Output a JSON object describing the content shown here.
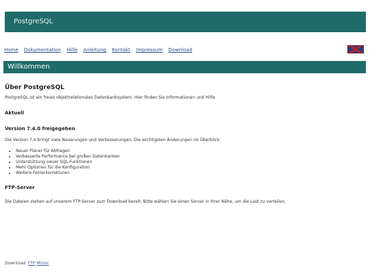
{
  "brand": "PostgreSQL",
  "nav_items": [
    "Home",
    "Dokumentation",
    "Hilfe",
    "Anleitung",
    "Kontakt",
    "Impressum",
    "Download"
  ],
  "section_title": "Willkommen",
  "article": {
    "heading": "Über PostgreSQL",
    "intro": "PostgreSQL ist ein freies objektrelationales Datenbanksystem. Hier finden Sie Informationen und Hilfe.",
    "news_heading": "Aktuell",
    "subheading": "Version 7.4.0 freigegeben",
    "body": "Die Version 7.4 bringt viele Neuerungen und Verbesserungen. Die wichtigsten Änderungen im Überblick:",
    "list": [
      "Neuer Planer für Abfragen",
      "Verbesserte Performance bei großen Datenbanken",
      "Unterstützung neuer SQL-Funktionen",
      "Mehr Optionen für die Konfiguration",
      "Weitere Fehlerkorrekturen"
    ],
    "ftp_heading": "FTP-Server",
    "ftp_text": "Die Dateien stehen auf unserem FTP-Server zum Download bereit. Bitte wählen Sie einen Server in Ihrer Nähe, um die Last zu verteilen."
  },
  "breadcrumb": {
    "prefix": "Download:",
    "link1": "FTP",
    "link2": "Mirror"
  }
}
